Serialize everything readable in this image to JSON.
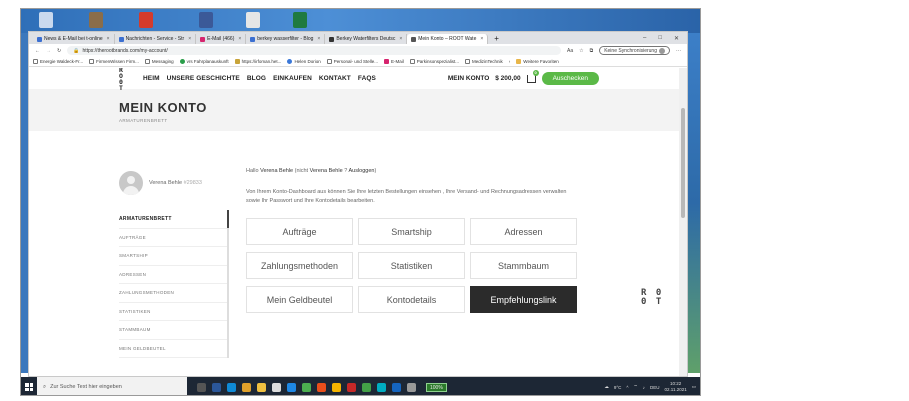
{
  "browser": {
    "tabs": [
      {
        "label": "News & E-Mail bei t-online",
        "active": false
      },
      {
        "label": "Nachrichten - Service - Str",
        "active": false
      },
      {
        "label": "E-Mail (466)",
        "active": false
      },
      {
        "label": "berkey wasserfilter - Blog",
        "active": false
      },
      {
        "label": "Berkey Waterfilters Deutsc",
        "active": false
      },
      {
        "label": "Mein Konto – ROOT Wate",
        "active": true
      }
    ],
    "new_tab": "+",
    "url": "https://therootbrands.com/my-account/",
    "sync_label": "Keine Synchronisierung",
    "bookmarks": [
      "Energie Waldeck-Fr...",
      "FirmenWissen Firm...",
      "Messaging",
      "vrs Fahrplanauskunft",
      "https://irfoman.het...",
      "Helen Dorion",
      "Personal- und Stelle...",
      "E-Mail",
      "Parkinsonspezialist...",
      "MedizinTechnik"
    ],
    "bookmarks_more": "Weitere Favoriten"
  },
  "site": {
    "logo_line1": "R O",
    "logo_line2": "0 T",
    "nav": [
      "HEIM",
      "UNSERE GESCHICHTE",
      "BLOG",
      "EINKAUFEN",
      "KONTAKT",
      "FAQS"
    ],
    "account_link": "MEIN KONTO",
    "cart_total": "$ 200,00",
    "cart_count": "0",
    "checkout_label": "Auschecken",
    "page_title": "MEIN KONTO",
    "page_subtitle": "ARMATURENBRETT",
    "profile_name": "Verena Behle",
    "profile_id": "#29833",
    "side_menu": [
      "ARMATURENBRETT",
      "AUFTRÄGE",
      "SMARTSHIP",
      "ADRESSEN",
      "ZAHLUNGSMETHODEN",
      "STATISTIKEN",
      "STAMMBAUM",
      "MEIN GELDBEUTEL"
    ],
    "welcome": {
      "hello": "Hallo",
      "name": "Verena Behle",
      "not_prefix": "(nicht",
      "not_name": "Verena Behle",
      "logout_q": "?",
      "logout": "Ausloggen",
      "close": ")"
    },
    "intro": {
      "p1": "Von Ihrem Konto-Dashboard aus können Sie Ihre",
      "link1": "letzten Bestellungen",
      "p2": "einsehen , Ihre",
      "link2": "Versand- und Rechnungsadressen",
      "p3": "verwalten sowie",
      "link3": "Ihr Passwort und Ihre Kontodetails bearbeiten",
      "p4": "."
    },
    "dashboard_buttons": [
      {
        "label": "Aufträge",
        "dark": false
      },
      {
        "label": "Smartship",
        "dark": false
      },
      {
        "label": "Adressen",
        "dark": false
      },
      {
        "label": "Zahlungsmethoden",
        "dark": false
      },
      {
        "label": "Statistiken",
        "dark": false
      },
      {
        "label": "Stammbaum",
        "dark": false
      },
      {
        "label": "Mein Geldbeutel",
        "dark": false
      },
      {
        "label": "Kontodetails",
        "dark": false
      },
      {
        "label": "Empfehlungslink",
        "dark": true
      }
    ],
    "corner_logo_line1": "R 0",
    "corner_logo_line2": "0 T"
  },
  "taskbar": {
    "search_placeholder": "Zur Suche Text hier eingeben",
    "zoom_badge": "100%",
    "weather": "9°C",
    "language": "DEU",
    "time": "10:22",
    "date": "02.11.2021"
  }
}
